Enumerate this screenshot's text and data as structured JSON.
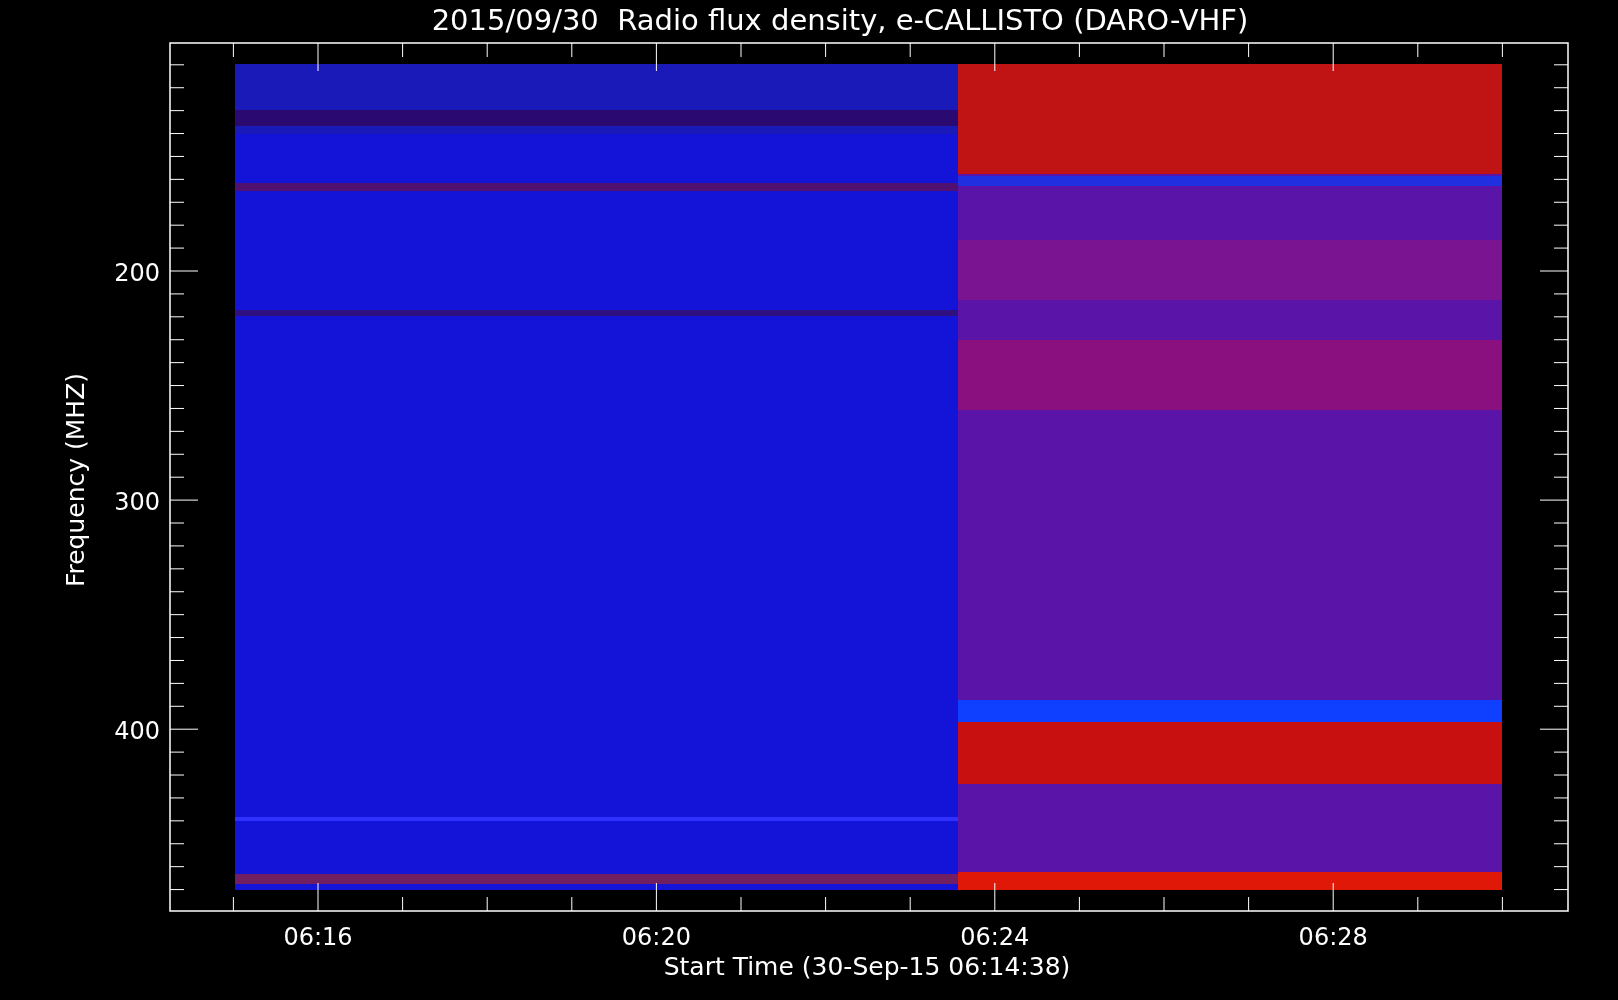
{
  "title": "2015/09/30  Radio flux density, e-CALLISTO (DARO-VHF)",
  "y_axis": {
    "label": "Frequency (MHZ)",
    "ticks": [
      "200",
      "300",
      "400"
    ]
  },
  "x_axis": {
    "label": "Start Time (30-Sep-15 06:14:38)",
    "ticks": [
      "06:16",
      "06:20",
      "06:24",
      "06:28"
    ]
  }
}
